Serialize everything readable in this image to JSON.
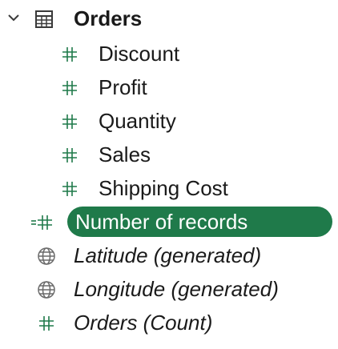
{
  "group": {
    "label": "Orders",
    "expanded": true,
    "icon": "table-icon",
    "chevron_icon": "chevron-down-icon"
  },
  "fields": [
    {
      "label": "Discount",
      "icon": "measure-icon"
    },
    {
      "label": "Profit",
      "icon": "measure-icon"
    },
    {
      "label": "Quantity",
      "icon": "measure-icon"
    },
    {
      "label": "Sales",
      "icon": "measure-icon"
    },
    {
      "label": "Shipping Cost",
      "icon": "measure-icon"
    }
  ],
  "selected_field": {
    "label": "Number of records",
    "icon": "calculated-measure-icon",
    "highlight_color": "#1f7a4a"
  },
  "generated_fields": [
    {
      "label": "Latitude (generated)",
      "icon": "globe-icon"
    },
    {
      "label": "Longitude (generated)",
      "icon": "globe-icon"
    },
    {
      "label": "Orders (Count)",
      "icon": "measure-icon"
    }
  ],
  "colors": {
    "text": "#1a1a1a",
    "icon_green": "#1f7a4a",
    "icon_gray": "#6b6b6b",
    "selection_bg": "#1f7a4a",
    "selection_text": "#ffffff"
  }
}
